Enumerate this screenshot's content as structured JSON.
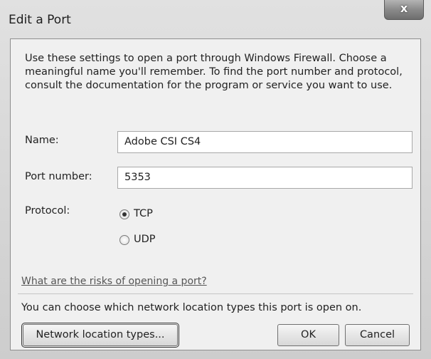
{
  "window": {
    "title": "Edit a Port",
    "close_glyph": "x"
  },
  "dialog": {
    "description": "Use these settings to open a port through Windows Firewall. Choose a meaningful name you'll remember. To find the port number and protocol, consult the documentation for the program or service you want to use.",
    "name_label": "Name:",
    "name_value": "Adobe CSI CS4",
    "port_label": "Port number:",
    "port_value": "5353",
    "protocol_label": "Protocol:",
    "protocol_options": [
      "TCP",
      "UDP"
    ],
    "protocol_selected": "TCP",
    "risks_link": "What are the risks of opening a port?",
    "location_info": "You can choose which network location types this port is open on."
  },
  "buttons": {
    "network_location": "Network location types...",
    "ok": "OK",
    "cancel": "Cancel"
  }
}
